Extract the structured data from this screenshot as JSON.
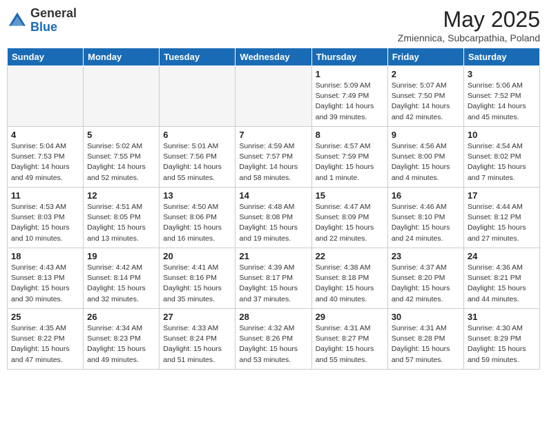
{
  "header": {
    "logo_general": "General",
    "logo_blue": "Blue",
    "month": "May 2025",
    "location": "Zmiennica, Subcarpathia, Poland"
  },
  "weekdays": [
    "Sunday",
    "Monday",
    "Tuesday",
    "Wednesday",
    "Thursday",
    "Friday",
    "Saturday"
  ],
  "weeks": [
    [
      {
        "day": "",
        "info": ""
      },
      {
        "day": "",
        "info": ""
      },
      {
        "day": "",
        "info": ""
      },
      {
        "day": "",
        "info": ""
      },
      {
        "day": "1",
        "info": "Sunrise: 5:09 AM\nSunset: 7:49 PM\nDaylight: 14 hours\nand 39 minutes."
      },
      {
        "day": "2",
        "info": "Sunrise: 5:07 AM\nSunset: 7:50 PM\nDaylight: 14 hours\nand 42 minutes."
      },
      {
        "day": "3",
        "info": "Sunrise: 5:06 AM\nSunset: 7:52 PM\nDaylight: 14 hours\nand 45 minutes."
      }
    ],
    [
      {
        "day": "4",
        "info": "Sunrise: 5:04 AM\nSunset: 7:53 PM\nDaylight: 14 hours\nand 49 minutes."
      },
      {
        "day": "5",
        "info": "Sunrise: 5:02 AM\nSunset: 7:55 PM\nDaylight: 14 hours\nand 52 minutes."
      },
      {
        "day": "6",
        "info": "Sunrise: 5:01 AM\nSunset: 7:56 PM\nDaylight: 14 hours\nand 55 minutes."
      },
      {
        "day": "7",
        "info": "Sunrise: 4:59 AM\nSunset: 7:57 PM\nDaylight: 14 hours\nand 58 minutes."
      },
      {
        "day": "8",
        "info": "Sunrise: 4:57 AM\nSunset: 7:59 PM\nDaylight: 15 hours\nand 1 minute."
      },
      {
        "day": "9",
        "info": "Sunrise: 4:56 AM\nSunset: 8:00 PM\nDaylight: 15 hours\nand 4 minutes."
      },
      {
        "day": "10",
        "info": "Sunrise: 4:54 AM\nSunset: 8:02 PM\nDaylight: 15 hours\nand 7 minutes."
      }
    ],
    [
      {
        "day": "11",
        "info": "Sunrise: 4:53 AM\nSunset: 8:03 PM\nDaylight: 15 hours\nand 10 minutes."
      },
      {
        "day": "12",
        "info": "Sunrise: 4:51 AM\nSunset: 8:05 PM\nDaylight: 15 hours\nand 13 minutes."
      },
      {
        "day": "13",
        "info": "Sunrise: 4:50 AM\nSunset: 8:06 PM\nDaylight: 15 hours\nand 16 minutes."
      },
      {
        "day": "14",
        "info": "Sunrise: 4:48 AM\nSunset: 8:08 PM\nDaylight: 15 hours\nand 19 minutes."
      },
      {
        "day": "15",
        "info": "Sunrise: 4:47 AM\nSunset: 8:09 PM\nDaylight: 15 hours\nand 22 minutes."
      },
      {
        "day": "16",
        "info": "Sunrise: 4:46 AM\nSunset: 8:10 PM\nDaylight: 15 hours\nand 24 minutes."
      },
      {
        "day": "17",
        "info": "Sunrise: 4:44 AM\nSunset: 8:12 PM\nDaylight: 15 hours\nand 27 minutes."
      }
    ],
    [
      {
        "day": "18",
        "info": "Sunrise: 4:43 AM\nSunset: 8:13 PM\nDaylight: 15 hours\nand 30 minutes."
      },
      {
        "day": "19",
        "info": "Sunrise: 4:42 AM\nSunset: 8:14 PM\nDaylight: 15 hours\nand 32 minutes."
      },
      {
        "day": "20",
        "info": "Sunrise: 4:41 AM\nSunset: 8:16 PM\nDaylight: 15 hours\nand 35 minutes."
      },
      {
        "day": "21",
        "info": "Sunrise: 4:39 AM\nSunset: 8:17 PM\nDaylight: 15 hours\nand 37 minutes."
      },
      {
        "day": "22",
        "info": "Sunrise: 4:38 AM\nSunset: 8:18 PM\nDaylight: 15 hours\nand 40 minutes."
      },
      {
        "day": "23",
        "info": "Sunrise: 4:37 AM\nSunset: 8:20 PM\nDaylight: 15 hours\nand 42 minutes."
      },
      {
        "day": "24",
        "info": "Sunrise: 4:36 AM\nSunset: 8:21 PM\nDaylight: 15 hours\nand 44 minutes."
      }
    ],
    [
      {
        "day": "25",
        "info": "Sunrise: 4:35 AM\nSunset: 8:22 PM\nDaylight: 15 hours\nand 47 minutes."
      },
      {
        "day": "26",
        "info": "Sunrise: 4:34 AM\nSunset: 8:23 PM\nDaylight: 15 hours\nand 49 minutes."
      },
      {
        "day": "27",
        "info": "Sunrise: 4:33 AM\nSunset: 8:24 PM\nDaylight: 15 hours\nand 51 minutes."
      },
      {
        "day": "28",
        "info": "Sunrise: 4:32 AM\nSunset: 8:26 PM\nDaylight: 15 hours\nand 53 minutes."
      },
      {
        "day": "29",
        "info": "Sunrise: 4:31 AM\nSunset: 8:27 PM\nDaylight: 15 hours\nand 55 minutes."
      },
      {
        "day": "30",
        "info": "Sunrise: 4:31 AM\nSunset: 8:28 PM\nDaylight: 15 hours\nand 57 minutes."
      },
      {
        "day": "31",
        "info": "Sunrise: 4:30 AM\nSunset: 8:29 PM\nDaylight: 15 hours\nand 59 minutes."
      }
    ]
  ]
}
